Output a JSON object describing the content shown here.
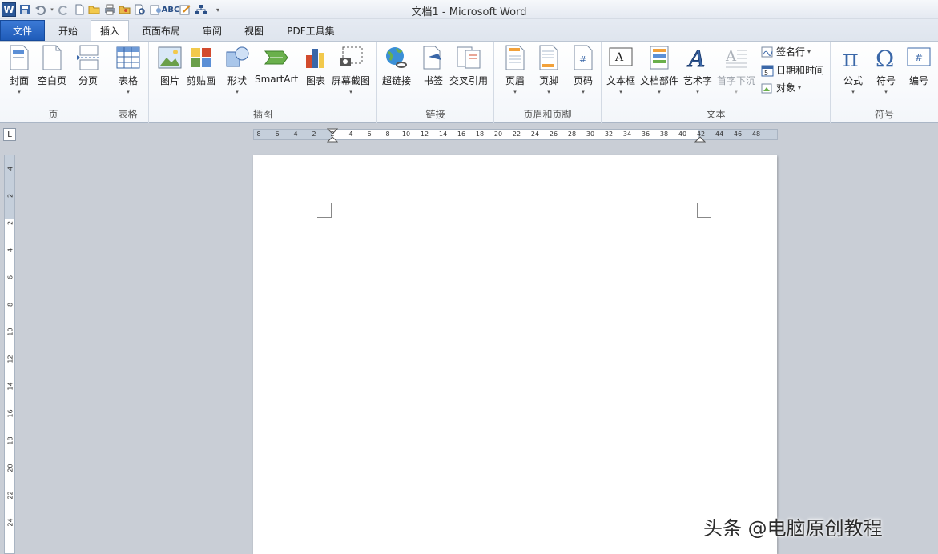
{
  "titlebar": {
    "title": "文档1  -  Microsoft Word",
    "logo": "W"
  },
  "qat": {
    "icons": [
      "save-icon",
      "undo-icon",
      "redo-icon",
      "new-icon",
      "open-icon",
      "print-icon",
      "folder-icon",
      "print-preview-icon",
      "spelling-icon",
      "track-icon",
      "tree-icon",
      "customize-icon"
    ]
  },
  "tabs": {
    "file": "文件",
    "home": "开始",
    "insert": "插入",
    "layout": "页面布局",
    "review": "审阅",
    "view": "视图",
    "pdf": "PDF工具集"
  },
  "ribbon": {
    "groups": {
      "pages": "页",
      "table": "表格",
      "illustrations": "插图",
      "links": "链接",
      "header_footer": "页眉和页脚",
      "text": "文本",
      "symbols": "符号"
    },
    "buttons": {
      "cover": "封面",
      "blank_page": "空白页",
      "page_break": "分页",
      "table": "表格",
      "picture": "图片",
      "clipart": "剪贴画",
      "shapes": "形状",
      "smartart": "SmartArt",
      "chart": "图表",
      "screenshot": "屏幕截图",
      "hyperlink": "超链接",
      "bookmark": "书签",
      "crossref": "交叉引用",
      "header": "页眉",
      "footer": "页脚",
      "page_number": "页码",
      "textbox": "文本框",
      "quick_parts": "文档部件",
      "wordart": "艺术字",
      "dropcap": "首字下沉",
      "signature": "签名行",
      "datetime": "日期和时间",
      "object": "对象",
      "equation": "公式",
      "symbol": "符号",
      "number": "编号"
    }
  },
  "ruler": {
    "h_ticks": [
      "8",
      "6",
      "4",
      "2",
      "2",
      "4",
      "6",
      "8",
      "10",
      "12",
      "14",
      "16",
      "18",
      "20",
      "22",
      "24",
      "26",
      "28",
      "30",
      "32",
      "34",
      "36",
      "38",
      "40",
      "42",
      "44",
      "46",
      "48"
    ],
    "v_ticks": [
      "4",
      "2",
      "2",
      "4",
      "6",
      "8",
      "10",
      "12",
      "14",
      "16",
      "18",
      "20",
      "22",
      "24"
    ],
    "corner": "L"
  },
  "watermark": "头条 @电脑原创教程"
}
